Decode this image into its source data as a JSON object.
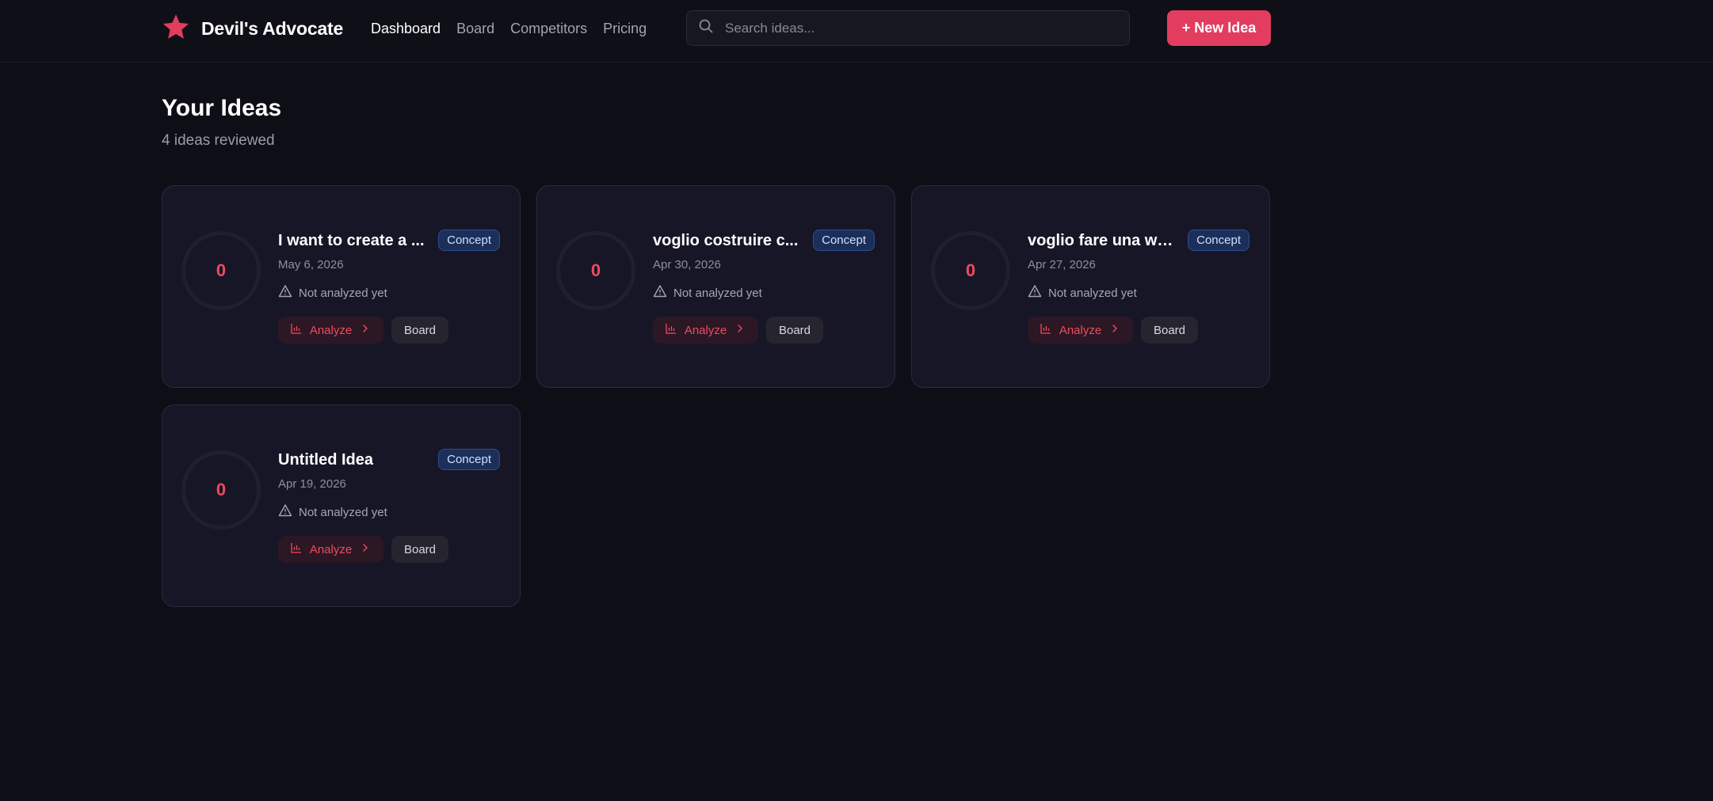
{
  "header": {
    "brand_name": "Devil's Advocate",
    "nav": [
      {
        "label": "Dashboard",
        "active": true
      },
      {
        "label": "Board",
        "active": false
      },
      {
        "label": "Competitors",
        "active": false
      },
      {
        "label": "Pricing",
        "active": false
      }
    ],
    "search_placeholder": "Search ideas...",
    "new_button_label": "+ New Idea"
  },
  "main": {
    "title": "Your Ideas",
    "subtitle": "4 ideas reviewed",
    "cards": [
      {
        "score": "0",
        "title": "I want to create a ...",
        "badge": "Concept",
        "date": "May 6, 2026",
        "status": "Not analyzed yet",
        "analyze_label": "Analyze",
        "board_label": "Board"
      },
      {
        "score": "0",
        "title": "voglio costruire c...",
        "badge": "Concept",
        "date": "Apr 30, 2026",
        "status": "Not analyzed yet",
        "analyze_label": "Analyze",
        "board_label": "Board"
      },
      {
        "score": "0",
        "title": "voglio fare una we...",
        "badge": "Concept",
        "date": "Apr 27, 2026",
        "status": "Not analyzed yet",
        "analyze_label": "Analyze",
        "board_label": "Board"
      },
      {
        "score": "0",
        "title": "Untitled Idea",
        "badge": "Concept",
        "date": "Apr 19, 2026",
        "status": "Not analyzed yet",
        "analyze_label": "Analyze",
        "board_label": "Board"
      }
    ]
  },
  "colors": {
    "accent": "#e23d5f",
    "background": "#0e0e16",
    "card": "#171627",
    "badge": "#1b2f5a"
  },
  "icons": [
    "star-logo-icon",
    "search-icon",
    "warning-icon",
    "bar-chart-icon",
    "chevron-right-icon"
  ]
}
